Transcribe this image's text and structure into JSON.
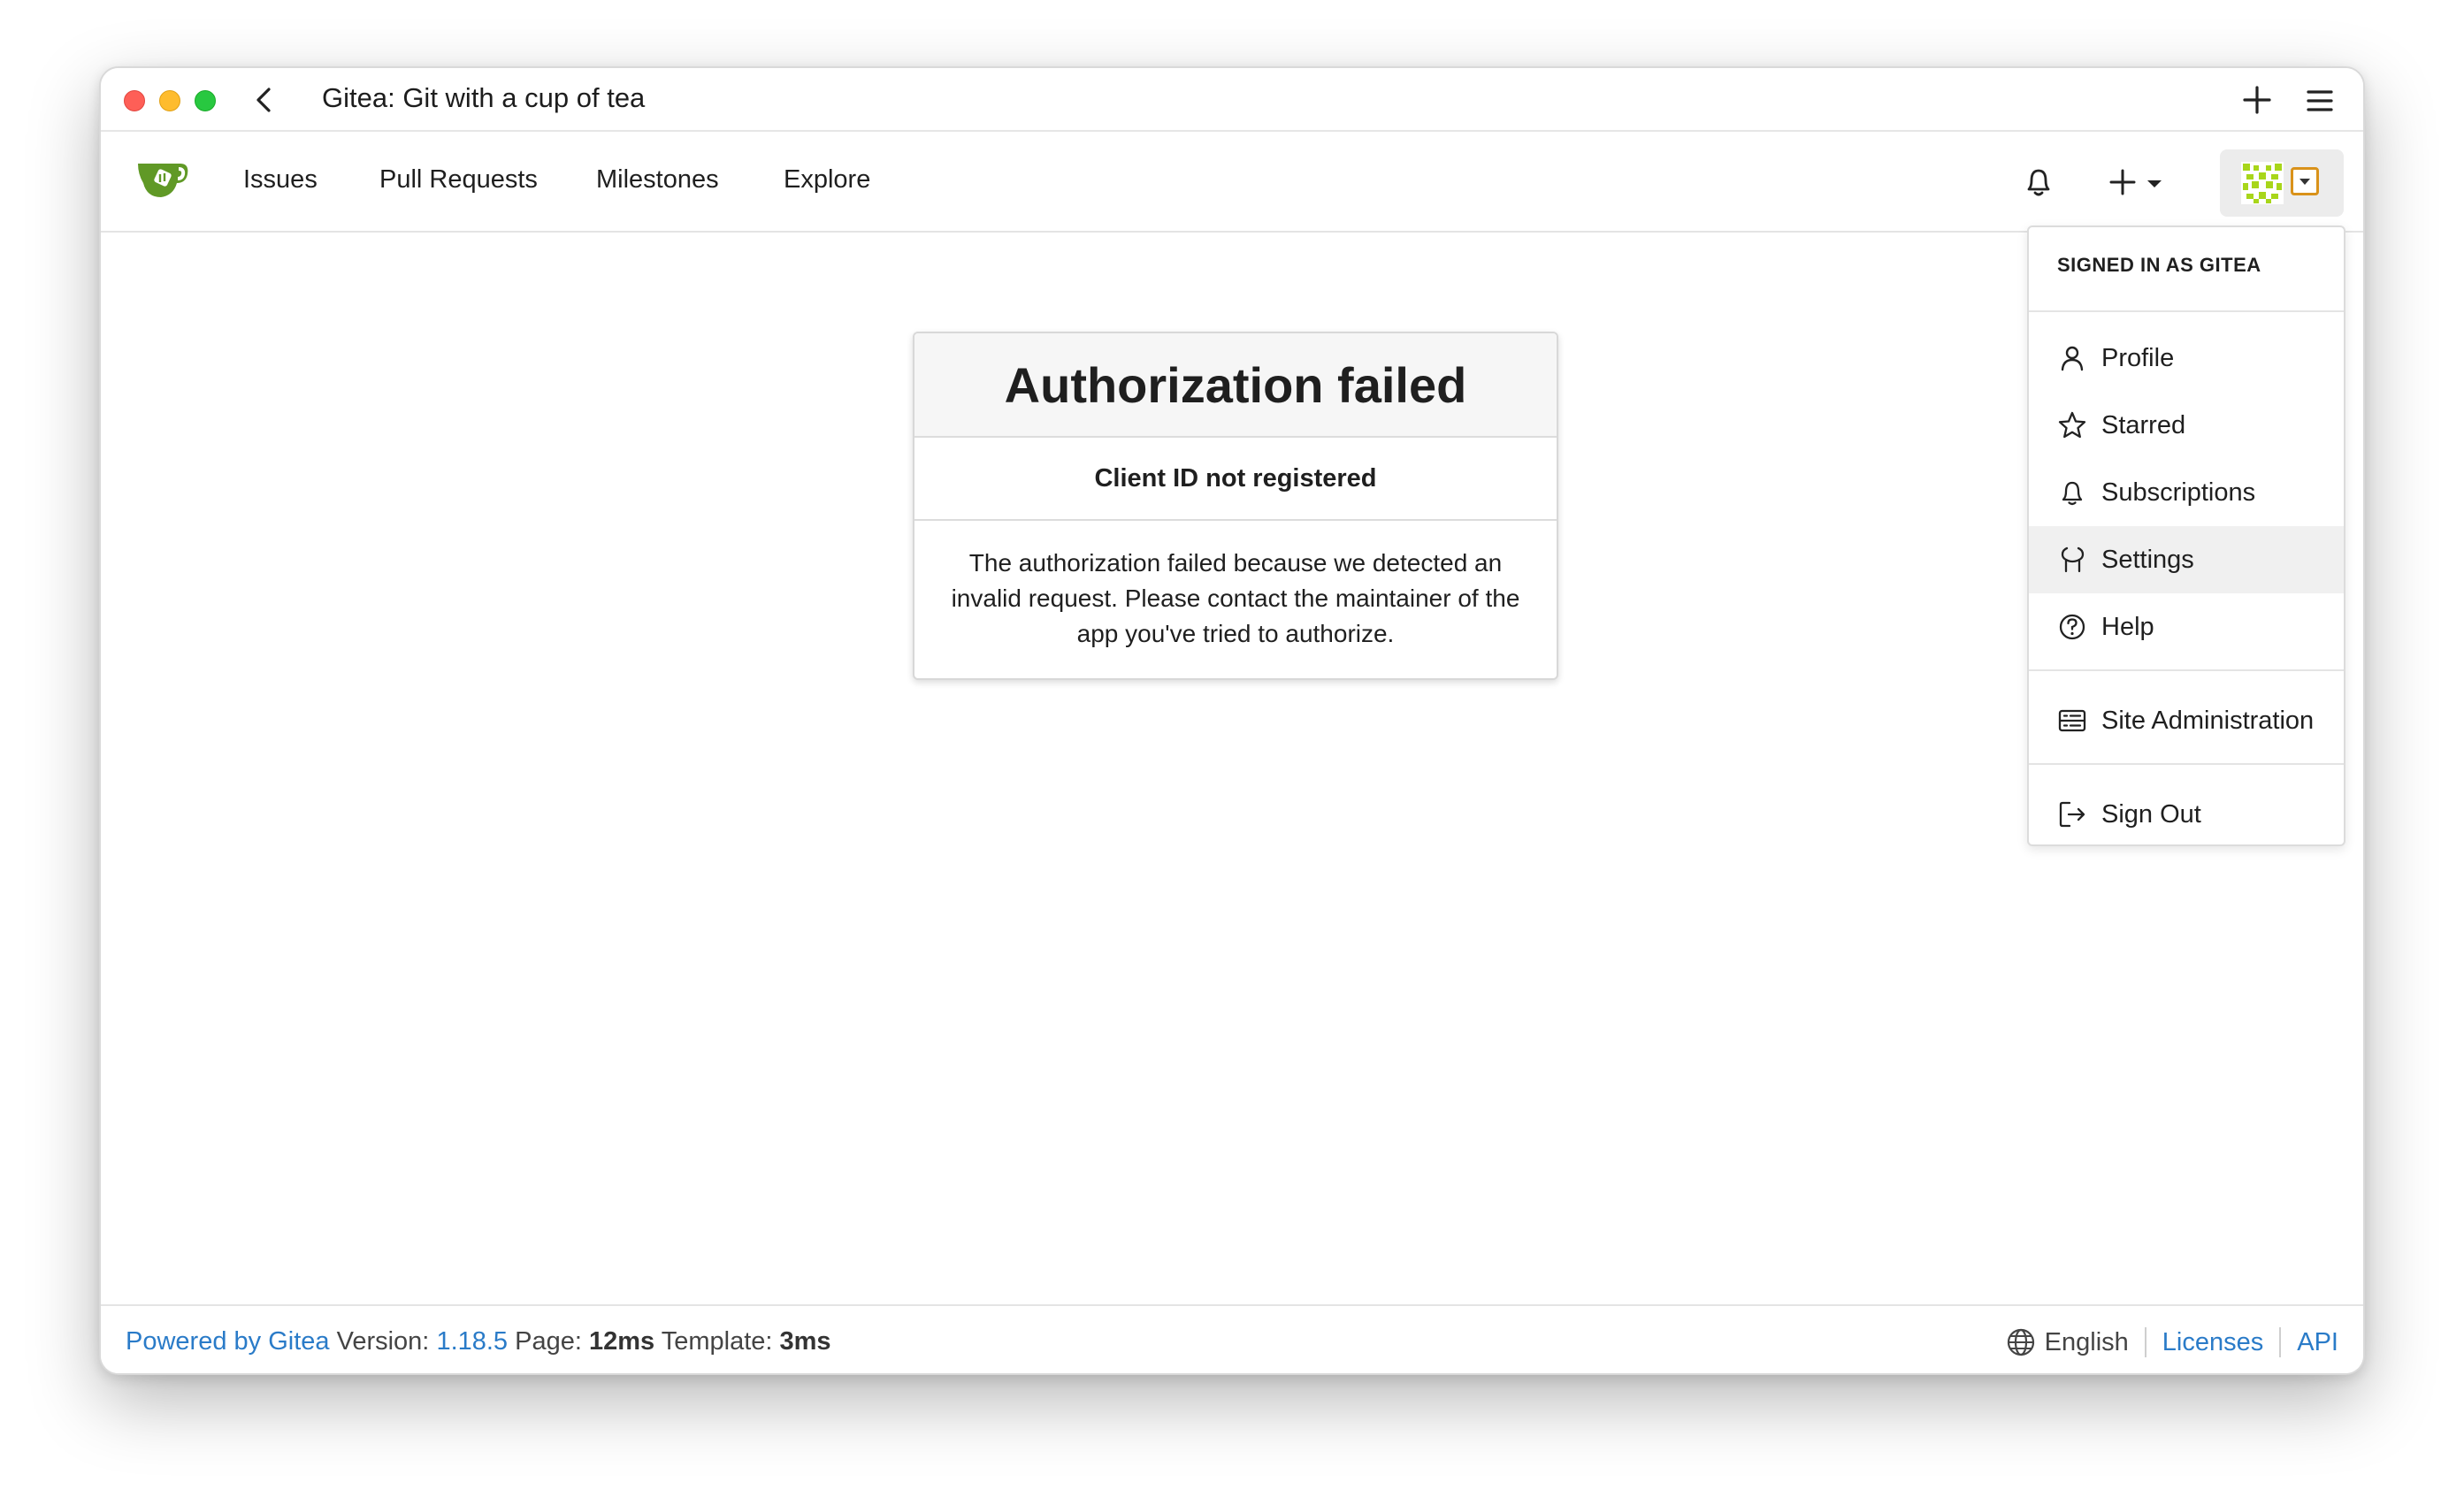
{
  "window": {
    "title": "Gitea: Git with a cup of tea"
  },
  "navbar": {
    "items": [
      {
        "label": "Issues"
      },
      {
        "label": "Pull Requests"
      },
      {
        "label": "Milestones"
      },
      {
        "label": "Explore"
      }
    ]
  },
  "auth": {
    "heading": "Authorization failed",
    "subheading": "Client ID not registered",
    "message": "The authorization failed because we detected an invalid request. Please contact the maintainer of the app you've tried to authorize."
  },
  "user_menu": {
    "header": "SIGNED IN AS GITEA",
    "items": [
      {
        "label": "Profile",
        "icon": "person-icon"
      },
      {
        "label": "Starred",
        "icon": "star-icon"
      },
      {
        "label": "Subscriptions",
        "icon": "bell-icon"
      },
      {
        "label": "Settings",
        "icon": "tools-icon"
      },
      {
        "label": "Help",
        "icon": "question-icon"
      },
      {
        "label": "Site Administration",
        "icon": "server-icon"
      },
      {
        "label": "Sign Out",
        "icon": "sign-out-icon"
      }
    ],
    "highlighted": "Settings"
  },
  "footer": {
    "powered_by": "Powered by Gitea",
    "version_label": "Version:",
    "version": "1.18.5",
    "page_label": "Page:",
    "page_time": "12ms",
    "template_label": "Template:",
    "template_time": "3ms",
    "language": "English",
    "licenses": "Licenses",
    "api": "API"
  },
  "colors": {
    "link": "#2a7bc8",
    "gitea_green": "#609926",
    "avatar_caret_border": "#d9921a"
  }
}
